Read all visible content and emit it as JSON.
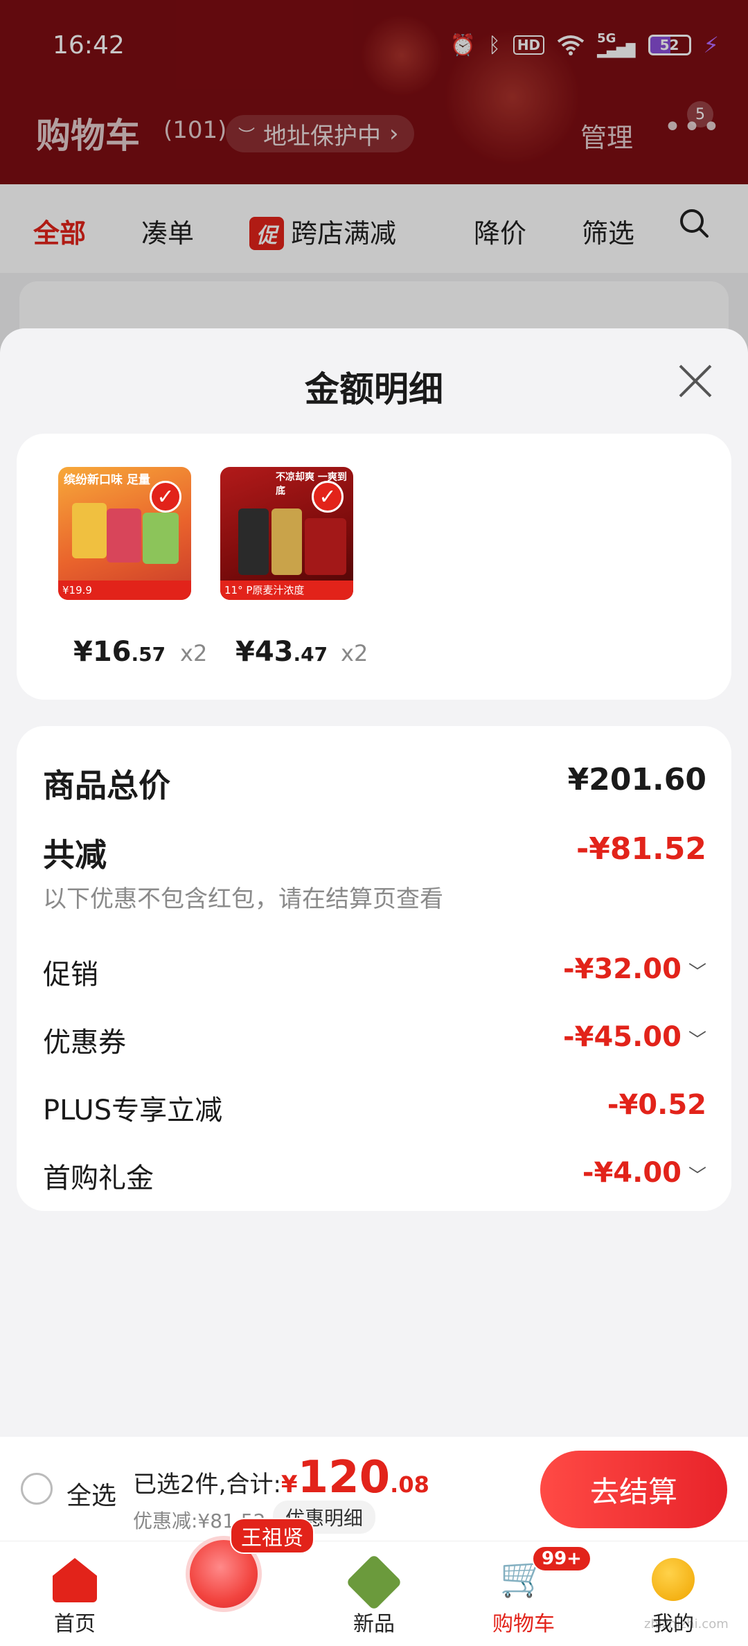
{
  "status_bar": {
    "time": "16:42",
    "battery": "52",
    "icons": [
      "alarm-icon",
      "bluetooth-icon",
      "hd-icon",
      "wifi-icon",
      "5g-signal-icon",
      "battery-icon",
      "charging-icon"
    ]
  },
  "header": {
    "title": "购物车",
    "count": "(101)",
    "address_protect": "地址保护中",
    "manage": "管理",
    "more_badge": "5"
  },
  "tabs": [
    {
      "label": "全部",
      "active": true
    },
    {
      "label": "凑单"
    },
    {
      "label": "跨店满减",
      "tag": "促"
    },
    {
      "label": "降价"
    },
    {
      "label": "筛选"
    }
  ],
  "sheet": {
    "title": "金额明细",
    "products": [
      {
        "image_text_top": "缤纷新口味 足量",
        "image_text_bottom": "¥19.9",
        "price_int": "¥16",
        "price_dec": ".57",
        "qty": "x2"
      },
      {
        "image_text_top": "不凉却爽 一爽到底",
        "image_text_bottom": "11° P原麦汁浓度",
        "price_int": "¥43",
        "price_dec": ".47",
        "qty": "x2"
      }
    ],
    "detail": {
      "total_label": "商品总价",
      "total_value": "¥201.60",
      "reduce_label": "共减",
      "reduce_value": "-¥81.52",
      "reduce_note": "以下优惠不包含红包，请在结算页查看",
      "rows": [
        {
          "label": "促销",
          "value": "-¥32.00",
          "expandable": true
        },
        {
          "label": "优惠券",
          "value": "-¥45.00",
          "expandable": true
        },
        {
          "label": "PLUS专享立减",
          "value": "-¥0.52",
          "expandable": false
        },
        {
          "label": "首购礼金",
          "value": "-¥4.00",
          "expandable": true
        }
      ]
    }
  },
  "checkout": {
    "select_all": "全选",
    "selected_text": "已选2件,合计:",
    "total_yen": "¥",
    "total_int": "120",
    "total_dec": ".08",
    "discount_text": "优惠减:¥81.52",
    "detail_pill": "优惠明细",
    "button": "去结算"
  },
  "bottom_nav": {
    "items": [
      {
        "label": "首页",
        "icon": "home-icon"
      },
      {
        "label": "",
        "icon": "center-avatar-icon",
        "badge": "王祖贤"
      },
      {
        "label": "新品",
        "icon": "new-products-icon"
      },
      {
        "label": "购物车",
        "icon": "cart-icon",
        "badge": "99+",
        "active": true
      },
      {
        "label": "我的",
        "icon": "profile-icon"
      }
    ]
  },
  "colors": {
    "header_bg": "#7d0d12",
    "accent_red": "#e2231a",
    "sheet_bg": "#f3f3f5"
  },
  "watermark": "zhizhizhi.com"
}
